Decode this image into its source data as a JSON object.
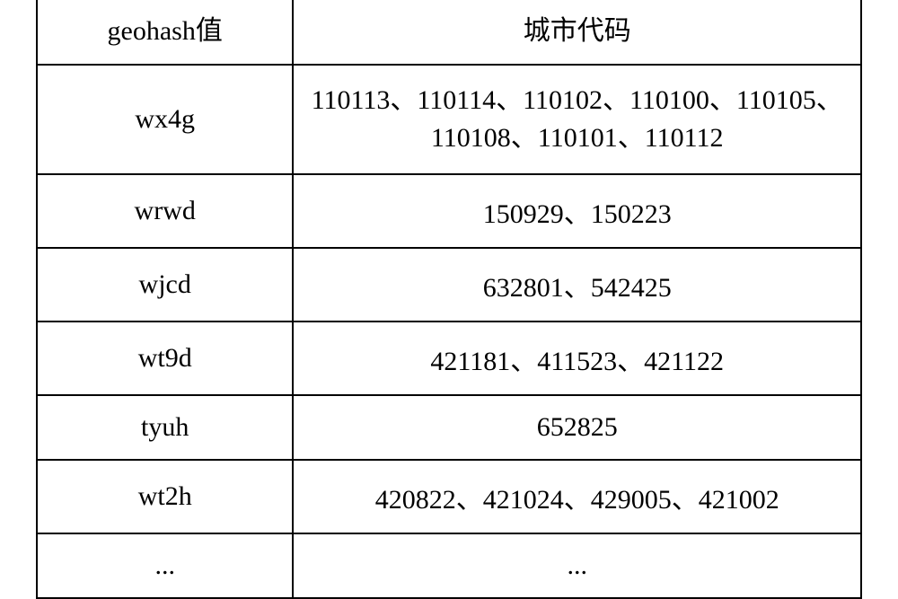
{
  "table": {
    "headers": {
      "geohash": "geohash值",
      "city_code": "城市代码"
    },
    "rows": [
      {
        "geohash": "wx4g",
        "city_code": "110113、110114、110102、110100、110105、110108、110101、110112"
      },
      {
        "geohash": "wrwd",
        "city_code": "150929、150223"
      },
      {
        "geohash": "wjcd",
        "city_code": "632801、542425"
      },
      {
        "geohash": "wt9d",
        "city_code": "421181、411523、421122"
      },
      {
        "geohash": "tyuh",
        "city_code": "652825"
      },
      {
        "geohash": "wt2h",
        "city_code": "420822、421024、429005、421002"
      },
      {
        "geohash": "...",
        "city_code": "..."
      }
    ]
  }
}
